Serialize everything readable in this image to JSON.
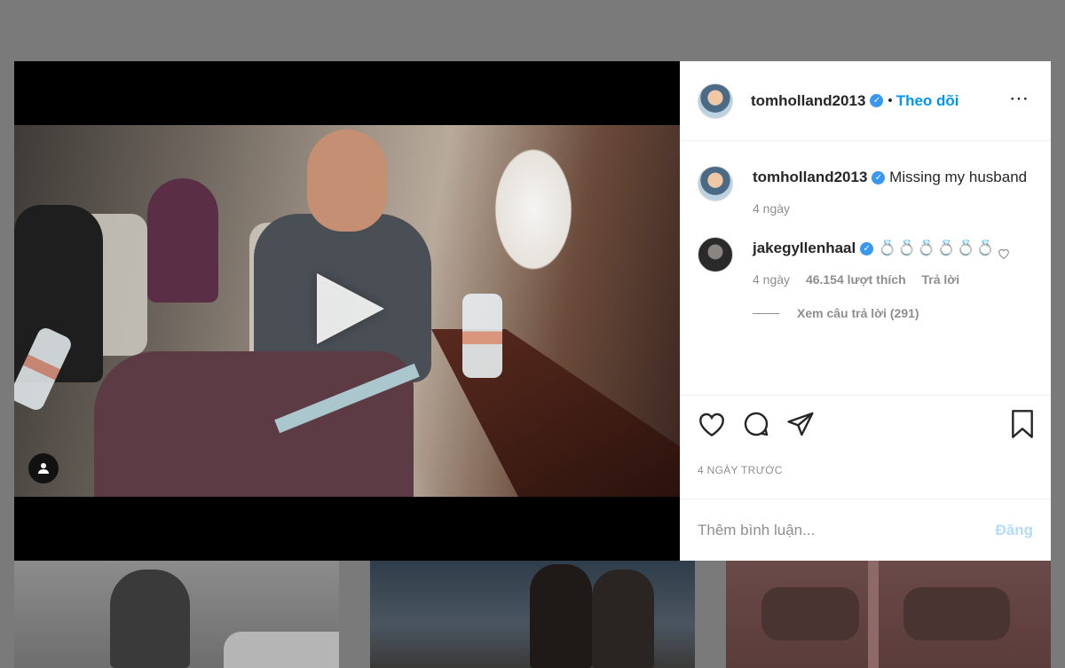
{
  "post": {
    "author": "tomholland2013",
    "follow_label": "Theo dõi",
    "separator": "•",
    "more_icon": "⋯",
    "caption": "Missing my husband",
    "caption_time": "4 ngày",
    "timestamp": "4 NGÀY TRƯỚC"
  },
  "comment": {
    "user": "jakegyllenhaal",
    "text": "💍💍💍💍💍💍",
    "time": "4 ngày",
    "likes": "46.154 lượt thích",
    "reply_label": "Trả lời",
    "view_replies": "Xem câu trả lời (291)"
  },
  "add_comment": {
    "placeholder": "Thêm bình luận...",
    "post_label": "Đăng"
  },
  "colors": {
    "accent": "#0095f6",
    "verified": "#3897f0",
    "muted": "#8e8e8e"
  },
  "icons": [
    "like-icon",
    "comment-icon",
    "share-icon",
    "bookmark-icon",
    "play-icon",
    "user-tag-icon",
    "verified-icon",
    "more-icon",
    "small-heart-icon"
  ]
}
